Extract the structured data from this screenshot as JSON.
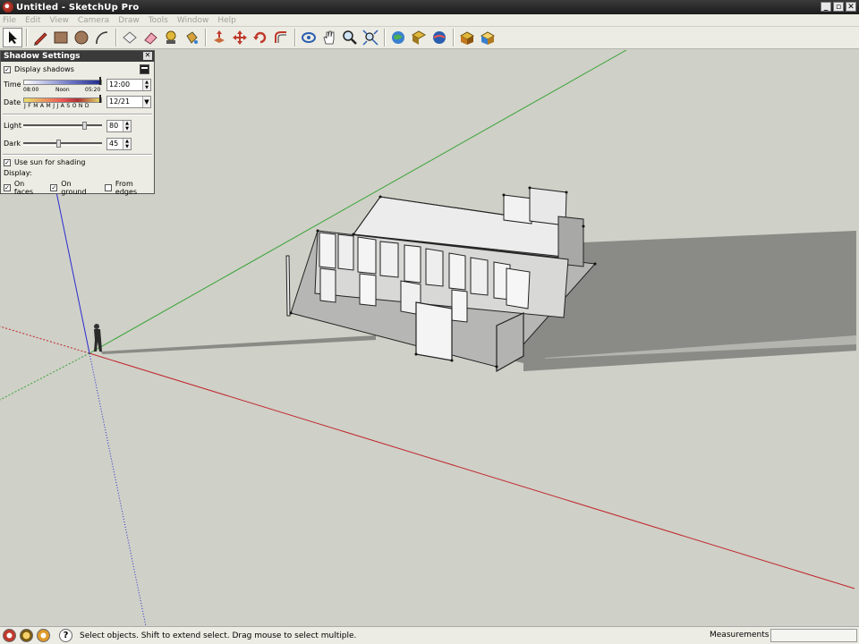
{
  "window": {
    "title": "Untitled - SketchUp Pro"
  },
  "menu": [
    "File",
    "Edit",
    "View",
    "Camera",
    "Draw",
    "Tools",
    "Window",
    "Help"
  ],
  "toolbar": {
    "tools": [
      "select-tool",
      "line-tool",
      "rectangle-tool",
      "circle-tool",
      "arc-tool",
      "make-component-tool",
      "eraser-tool",
      "tape-measure-tool",
      "paint-bucket-tool",
      "push-pull-tool",
      "move-tool",
      "rotate-tool",
      "offset-tool",
      "orbit-tool",
      "pan-tool",
      "zoom-tool",
      "zoom-extents-tool",
      "get-models-tool",
      "share-model-tool",
      "google-earth-tool",
      "components-tool",
      "photo-textures-tool"
    ]
  },
  "shadow_panel": {
    "title": "Shadow Settings",
    "display_shadows_label": "Display shadows",
    "display_shadows_checked": true,
    "time_label": "Time",
    "time_start": "08:00",
    "time_mid": "Noon",
    "time_end": "05:20",
    "time_value": "12:00",
    "date_label": "Date",
    "date_months": "J F M A M J J A S O N D",
    "date_value": "12/21",
    "light_label": "Light",
    "light_value": "80",
    "light_level": 0.8,
    "dark_label": "Dark",
    "dark_value": "45",
    "dark_level": 0.45,
    "use_sun_label": "Use sun for shading",
    "use_sun_checked": true,
    "display_label": "Display:",
    "on_faces_label": "On faces",
    "on_faces_checked": true,
    "on_ground_label": "On ground",
    "on_ground_checked": true,
    "from_edges_label": "From edges",
    "from_edges_checked": false
  },
  "status": {
    "hint": "Select objects. Shift to extend select. Drag mouse to select multiple.",
    "measurements_label": "Measurements",
    "measurements_value": ""
  },
  "colors": {
    "background": "#cfd0c7",
    "axis_red": "#c0262e",
    "axis_green": "#3aa33a",
    "axis_blue": "#2a2ad0",
    "shadow": "#8a8a86",
    "face_light": "#f2f2f2",
    "face_dark": "#b6b6b4"
  }
}
